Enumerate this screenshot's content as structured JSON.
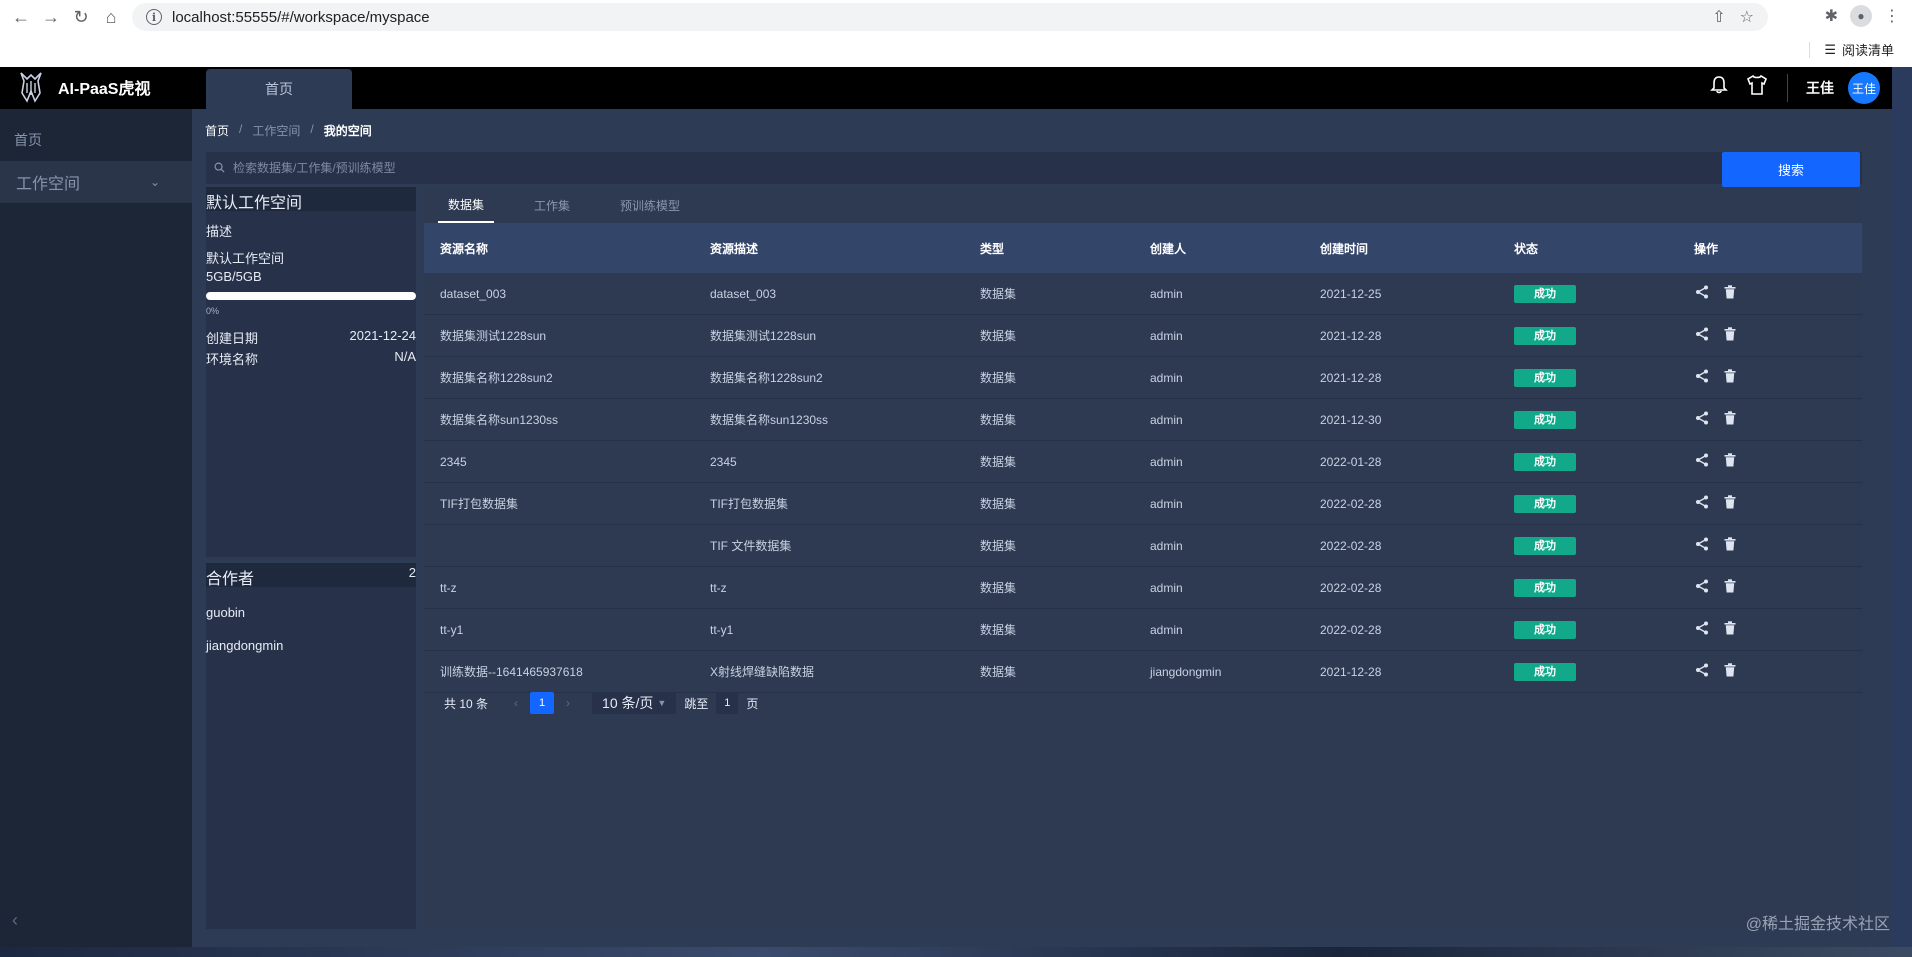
{
  "browser": {
    "url": "localhost:55555/#/workspace/myspace",
    "reading_list": "阅读清单"
  },
  "app": {
    "brand": "AI-PaaS虎视",
    "top_tab": "首页",
    "user_name": "王佳",
    "user_avatar": "王佳"
  },
  "sidebar": {
    "items": [
      {
        "label": "首页"
      },
      {
        "label": "工作空间"
      }
    ]
  },
  "breadcrumb": {
    "items": [
      "首页",
      "工作空间",
      "我的空间"
    ],
    "separator": "/"
  },
  "search": {
    "placeholder": "检索数据集/工作集/预训练模型",
    "button": "搜索"
  },
  "workspace": {
    "title": "默认工作空间",
    "desc_label": "描述",
    "desc_value": "默认工作空间",
    "storage": "5GB/5GB",
    "progress_label": "0%",
    "progress_fraction": 1.0,
    "created_label": "创建日期",
    "created_value": "2021-12-24",
    "env_label": "环境名称",
    "env_value": "N/A"
  },
  "collaborators": {
    "title": "合作者",
    "count": "2",
    "members": [
      "guobin",
      "jiangdongmin"
    ]
  },
  "tabs": [
    "数据集",
    "工作集",
    "预训练模型"
  ],
  "table": {
    "columns": [
      "资源名称",
      "资源描述",
      "类型",
      "创建人",
      "创建时间",
      "状态",
      "操作"
    ],
    "rows": [
      {
        "name": "dataset_003",
        "desc": "dataset_003",
        "type": "数据集",
        "creator": "admin",
        "time": "2021-12-25",
        "status": "成功"
      },
      {
        "name": "数据集测试1228sun",
        "desc": "数据集测试1228sun",
        "type": "数据集",
        "creator": "admin",
        "time": "2021-12-28",
        "status": "成功"
      },
      {
        "name": "数据集名称1228sun2",
        "desc": "数据集名称1228sun2",
        "type": "数据集",
        "creator": "admin",
        "time": "2021-12-28",
        "status": "成功"
      },
      {
        "name": "数据集名称sun1230ss",
        "desc": "数据集名称sun1230ss",
        "type": "数据集",
        "creator": "admin",
        "time": "2021-12-30",
        "status": "成功"
      },
      {
        "name": "2345",
        "desc": "2345",
        "type": "数据集",
        "creator": "admin",
        "time": "2022-01-28",
        "status": "成功"
      },
      {
        "name": "TIF打包数据集",
        "desc": "TIF打包数据集",
        "type": "数据集",
        "creator": "admin",
        "time": "2022-02-28",
        "status": "成功"
      },
      {
        "name": "",
        "desc": "TIF 文件数据集",
        "type": "数据集",
        "creator": "admin",
        "time": "2022-02-28",
        "status": "成功"
      },
      {
        "name": "tt-z",
        "desc": "tt-z",
        "type": "数据集",
        "creator": "admin",
        "time": "2022-02-28",
        "status": "成功"
      },
      {
        "name": "tt-y1",
        "desc": "tt-y1",
        "type": "数据集",
        "creator": "admin",
        "time": "2022-02-28",
        "status": "成功"
      },
      {
        "name": "训练数据--1641465937618",
        "desc": "X射线焊缝缺陷数据",
        "type": "数据集",
        "creator": "jiangdongmin",
        "time": "2021-12-28",
        "status": "成功"
      }
    ]
  },
  "pagination": {
    "total": "共 10 条",
    "current": "1",
    "page_size": "10 条/页",
    "jump_label": "跳至",
    "jump_value": "1",
    "page_label": "页"
  },
  "watermark": "@稀土掘金技术社区",
  "colors": {
    "accent": "#1366ff",
    "success": "#12a88a",
    "avatar": "#1677ff"
  }
}
